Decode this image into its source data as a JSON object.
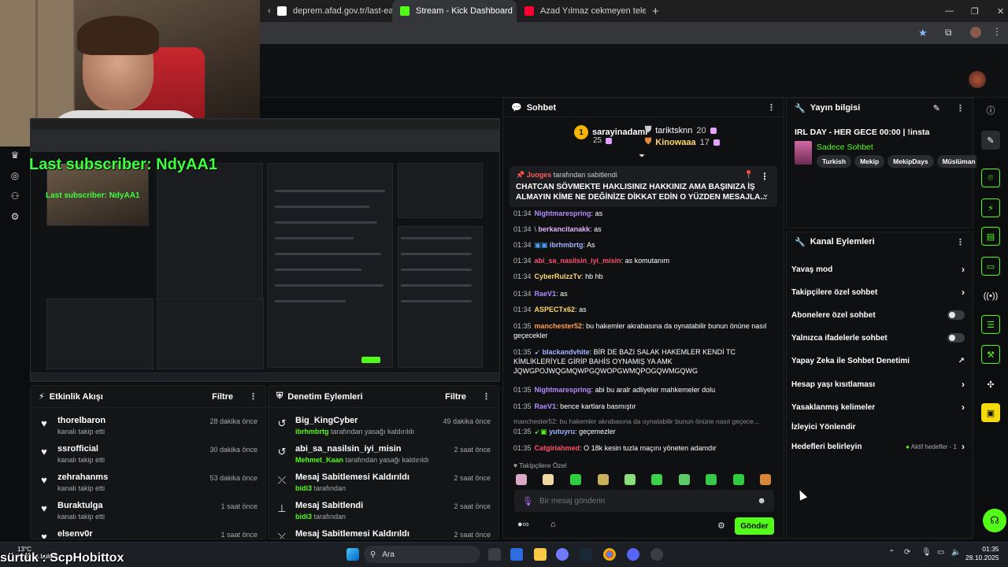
{
  "browser": {
    "tabs": [
      {
        "label": "deprem.afad.gov.tr/last-earthq",
        "active": false
      },
      {
        "label": "Stream - Kick Dashboard",
        "active": true
      },
      {
        "label": "Azad Yılmaz cekmeyen telefon",
        "active": false
      }
    ],
    "new_tab": "+"
  },
  "overlay": {
    "last_subscriber": "Last subscriber: NdyAA1",
    "follower_name": "sürtük : ScpHobittox",
    "weather_temp": "13°C",
    "weather_desc": "Kısmen bulutlu"
  },
  "activity": {
    "title": "Etkinlik Akışı",
    "filter_label": "Filtre",
    "items": [
      {
        "user": "thorelbaron",
        "action": "kanalı takip etti",
        "time": "28 dakika önce"
      },
      {
        "user": "ssrofficial",
        "action": "kanalı takip etti",
        "time": "30 dakika önce"
      },
      {
        "user": "zehrahanms",
        "action": "kanalı takip etti",
        "time": "53 dakika önce"
      },
      {
        "user": "Buraktulga",
        "action": "kanalı takip etti",
        "time": "1 saat önce"
      },
      {
        "user": "elsenv0r",
        "action": "",
        "time": "1 saat önce"
      }
    ]
  },
  "moderation": {
    "title": "Denetim Eylemleri",
    "filter_label": "Filtre",
    "items": [
      {
        "title": "Big_KingCyber",
        "actor": "ibrhmbrtg",
        "detail": "tarafından yasağı kaldırıldı",
        "time": "49 dakika önce",
        "icon": "unban-icon"
      },
      {
        "title": "abi_sa_nasilsin_iyi_misin",
        "actor": "Mehmet_Kaan",
        "detail": "tarafından yasağı kaldırıldı",
        "time": "2 saat önce",
        "icon": "unban-icon"
      },
      {
        "title": "Mesaj Sabitlemesi Kaldırıldı",
        "actor": "bidi3",
        "detail": "tarafından",
        "time": "2 saat önce",
        "icon": "unpin-icon"
      },
      {
        "title": "Mesaj Sabitlendi",
        "actor": "bidi3",
        "detail": "tarafından",
        "time": "2 saat önce",
        "icon": "pin-icon"
      },
      {
        "title": "Mesaj Sabitlemesi Kaldırıldı",
        "actor": "",
        "detail": "",
        "time": "2 saat önce",
        "icon": "unpin-icon"
      }
    ]
  },
  "chat": {
    "title": "Sohbet",
    "gifters": [
      {
        "rank": "1",
        "name": "sarayinadami",
        "count": "25"
      },
      {
        "rank": "",
        "name": "tariktsknn",
        "count": "20"
      },
      {
        "rank": "",
        "name": "Kinowaaa",
        "count": "17"
      }
    ],
    "pinned": {
      "by_user": "Juoges",
      "by_suffix": "tarafından sabitlendi",
      "message": "CHATCAN SÖVMEKTE HAKLISINIZ HAKKINIZ AMA BAŞINIZA İŞ ALMAYIN KİME NE DEĞİNİZE DİKKAT EDİN O YÜZDEN MESAJLA..."
    },
    "messages": [
      {
        "time": "01:34",
        "user": "Nightmarespring",
        "color": "#b28cff",
        "text": "as"
      },
      {
        "time": "01:34",
        "user": "berkancitanakk",
        "color": "#e0b6ff",
        "text": "as"
      },
      {
        "time": "01:34",
        "user": "ibrhmbrtg",
        "color": "#9fb4ff",
        "text": "As"
      },
      {
        "time": "01:34",
        "user": "abi_sa_nasilsin_iyi_misin",
        "color": "#ff4f6e",
        "text": "as komutanım"
      },
      {
        "time": "01:34",
        "user": "CyberRulzzTv",
        "color": "#ffd76b",
        "text": "hb hb"
      },
      {
        "time": "01:34",
        "user": "RaeV1",
        "color": "#b28cff",
        "text": "as"
      },
      {
        "time": "01:34",
        "user": "ASPECTx62",
        "color": "#ffd76b",
        "text": "as"
      },
      {
        "time": "01:35",
        "user": "manchester52",
        "color": "#ff9f4f",
        "text": "bu hakemler akrabasına da oynatabilir bunun önüne nasıl geçecekler"
      },
      {
        "time": "01:35",
        "user": "blackandvhite",
        "color": "#9fb4ff",
        "text": "BİR DE BAZI SALAK HAKEMLER KENDİ TC KİMLİKLERİYLE GİRİP BAHİS OYNAMIŞ YA AMK JQWGPOJWQGMQWPGQWOPGWMQPOGQWMGQWG"
      },
      {
        "time": "01:35",
        "user": "Nightmarespring",
        "color": "#b28cff",
        "text": "abi bu aralr adliyeler mahkemeler dolu"
      },
      {
        "time": "01:35",
        "user": "RaeV1",
        "color": "#b28cff",
        "text": "bence kartlara basmıştır"
      },
      {
        "time": "01:35",
        "user": "yutuyru",
        "color": "#9fb4ff",
        "text": "geçemezler",
        "reply": "manchester52: bu hakemler akrabasına da oynatabilir bunun önüne nasıl geçece..."
      },
      {
        "time": "01:35",
        "user": "Catgiriahmed",
        "color": "#ff4f6e",
        "text": "O 18k kesin tuzla maçını yöneten adamdır"
      }
    ],
    "emote_section": "Takipçilere Özel",
    "input_placeholder": "Bir mesaj gönderin",
    "send_label": "Gönder"
  },
  "stream_info": {
    "title": "Yayın bilgisi",
    "stream_title": "IRL DAY - HER GECE 00:00 | !insta",
    "category": "Sadece Sohbet",
    "tags": [
      "Turkish",
      "Mekip",
      "MekipDays",
      "Müslüman"
    ]
  },
  "channel_actions": {
    "title": "Kanal Eylemleri",
    "items": [
      {
        "label": "Yavaş mod",
        "control": "chevron"
      },
      {
        "label": "Takipçilere özel sohbet",
        "control": "chevron"
      },
      {
        "label": "Abonelere özel sohbet",
        "control": "toggle"
      },
      {
        "label": "Yalnızca ifadelerle sohbet",
        "control": "toggle"
      },
      {
        "label": "Yapay Zeka ile Sohbet Denetimi",
        "control": "external"
      },
      {
        "label": "Hesap yaşı kısıtlaması",
        "control": "chevron"
      },
      {
        "label": "Yasaklanmış kelimeler",
        "control": "chevron"
      },
      {
        "label": "İzleyici Yönlendir",
        "control": "none"
      },
      {
        "label": "Hedefleri belirleyin",
        "control": "chevron",
        "status": "Aktif hedefler - 1"
      }
    ]
  },
  "taskbar": {
    "search_placeholder": "Ara",
    "time": "01:35",
    "date": "28.10.2025"
  }
}
